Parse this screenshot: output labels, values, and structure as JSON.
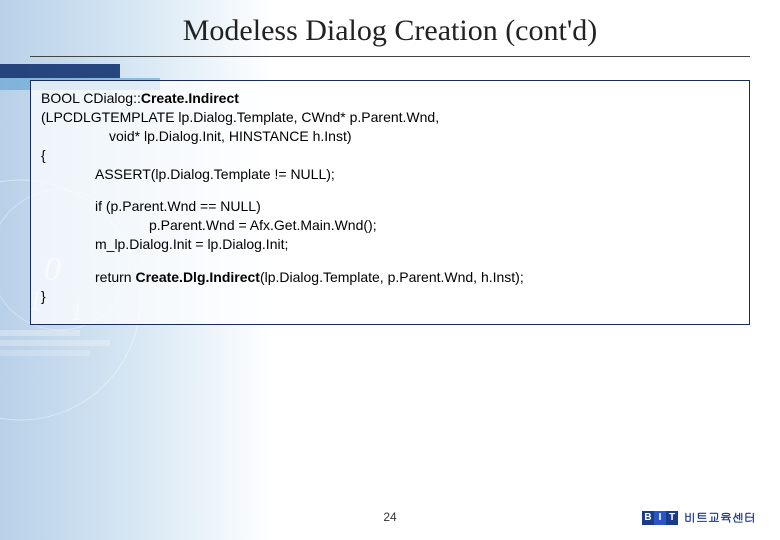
{
  "title": "Modeless Dialog Creation (cont'd)",
  "code": {
    "l1_a": "BOOL CDialog::",
    "l1_b": "Create.Indirect",
    "l2": "(LPCDLGTEMPLATE lp.Dialog.Template, CWnd* p.Parent.Wnd,",
    "l3": "void* lp.Dialog.Init, HINSTANCE h.Inst)",
    "l4": "{",
    "l5": "ASSERT(lp.Dialog.Template != NULL);",
    "l6": "if (p.Parent.Wnd == NULL)",
    "l7": "p.Parent.Wnd = Afx.Get.Main.Wnd();",
    "l8": "m_lp.Dialog.Init = lp.Dialog.Init;",
    "l9_a": "return ",
    "l9_b": "Create.Dlg.Indirect",
    "l9_c": "(lp.Dialog.Template, p.Parent.Wnd, h.Inst);",
    "l10": "}"
  },
  "page_number": "24",
  "footer": {
    "logo_b": "B",
    "logo_i": "I",
    "logo_t": "T",
    "text": "비트교육센터"
  }
}
